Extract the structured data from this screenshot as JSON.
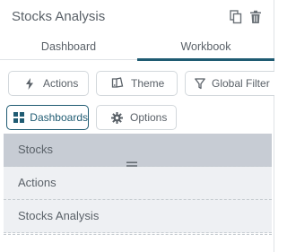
{
  "header": {
    "title": "Stocks Analysis",
    "icons": [
      "copy-icon",
      "trash-icon"
    ]
  },
  "tabs": [
    {
      "label": "Dashboard",
      "active": false
    },
    {
      "label": "Workbook",
      "active": true
    }
  ],
  "toolbar": {
    "actions_label": "Actions",
    "theme_label": "Theme",
    "global_filter_label": "Global Filter",
    "dashboards_label": "Dashboards",
    "options_label": "Options"
  },
  "list": {
    "items": [
      {
        "label": "Stocks",
        "selected": true
      },
      {
        "label": "Actions",
        "selected": false
      },
      {
        "label": "Stocks Analysis",
        "selected": false
      }
    ]
  },
  "colors": {
    "accent": "#1f5b72",
    "selected_row": "#c7ccd4",
    "row_bg": "#eef0f3"
  }
}
